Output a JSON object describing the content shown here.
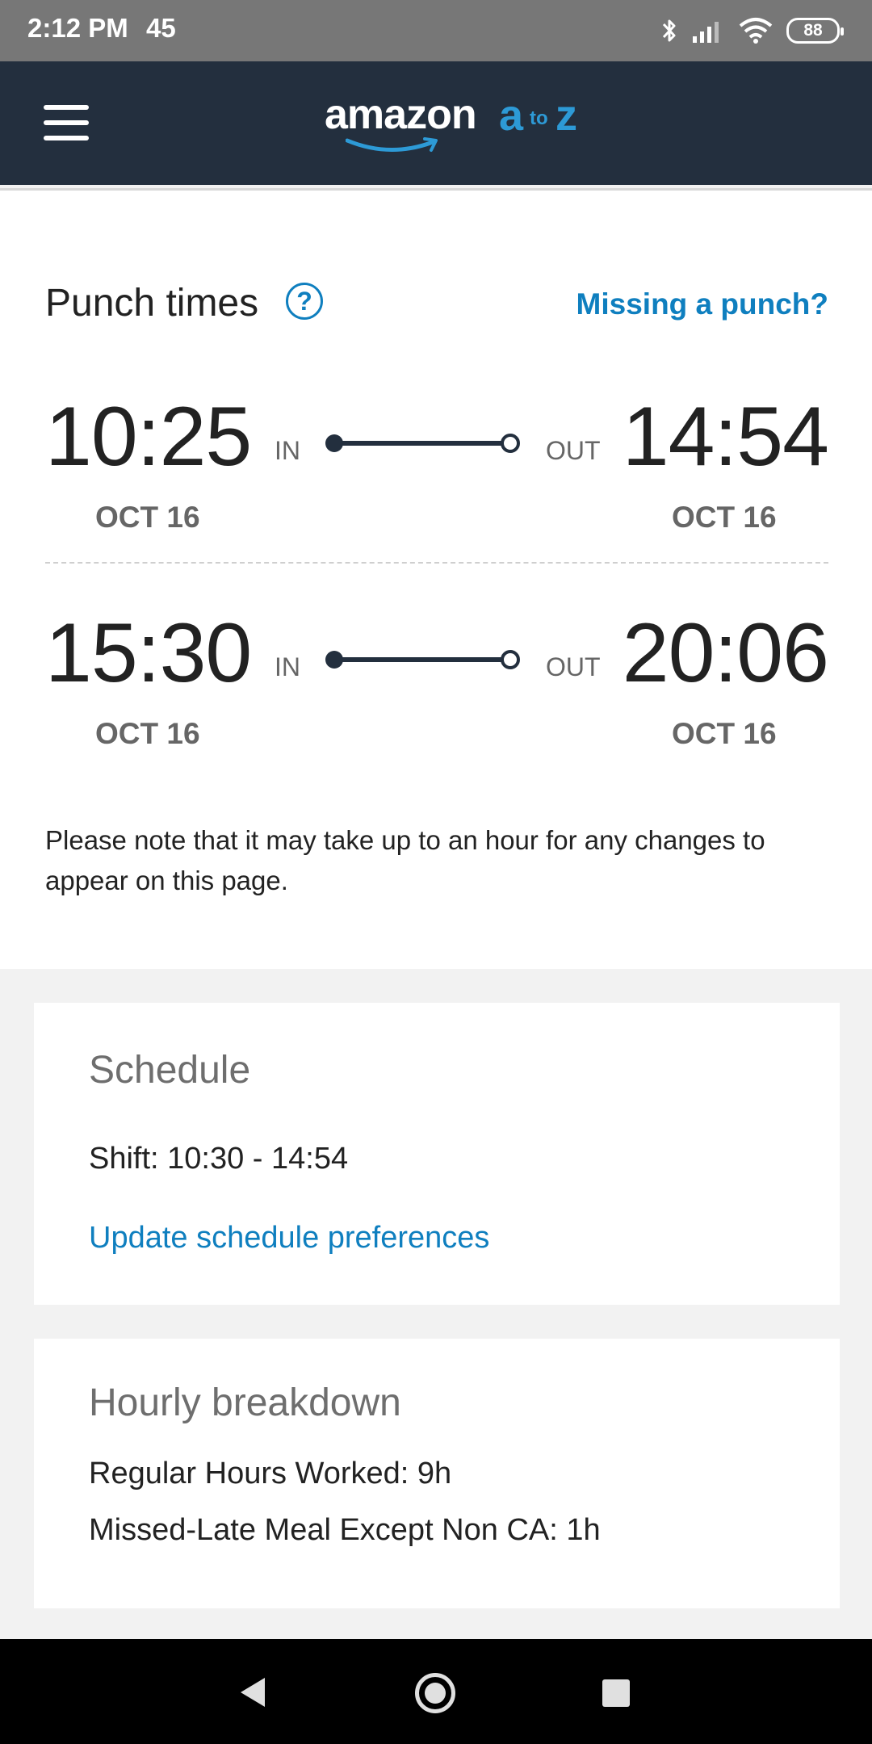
{
  "status_bar": {
    "time": "2:12 PM",
    "extra": "45",
    "battery": "88",
    "icons": [
      "bluetooth-icon",
      "signal-icon",
      "wifi-icon",
      "battery-icon"
    ]
  },
  "header": {
    "logo_amazon": "amazon",
    "logo_a": "a",
    "logo_to": "to",
    "logo_z": "z",
    "menu_icon": "hamburger-menu-icon"
  },
  "punch_times": {
    "title": "Punch times",
    "help_icon_label": "?",
    "missing_link": "Missing a punch?",
    "in_label": "IN",
    "out_label": "OUT",
    "rows": [
      {
        "in_time": "10:25",
        "in_date": "OCT 16",
        "out_time": "14:54",
        "out_date": "OCT 16"
      },
      {
        "in_time": "15:30",
        "in_date": "OCT 16",
        "out_time": "20:06",
        "out_date": "OCT 16"
      }
    ],
    "note": "Please note that it may take up to an hour for any changes to appear on this page."
  },
  "schedule": {
    "title": "Schedule",
    "shift": "Shift: 10:30 - 14:54",
    "update_link": "Update schedule preferences"
  },
  "hourly_breakdown": {
    "title": "Hourly breakdown",
    "lines": [
      "Regular Hours Worked: 9h",
      "Missed-Late Meal Except Non CA: 1h"
    ]
  },
  "nav_bar": {
    "back": "back-icon",
    "home": "home-icon",
    "recents": "recents-icon"
  },
  "colors": {
    "header_bg": "#232f3e",
    "accent": "#2d9ad6",
    "link": "#0f7fbf"
  }
}
